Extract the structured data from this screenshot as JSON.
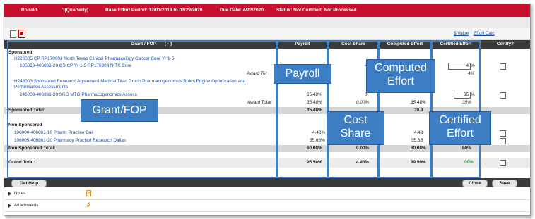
{
  "header": {
    "name": "Ronald",
    "type": "' (Quarterly)",
    "period": "Base Effort Period: 12/01/2019 to 02/29/2020",
    "due": "Due Date: 4/22/2020",
    "status": "Status: Not Certified, Not Processed"
  },
  "toolbar": {
    "value_link": "$ Value",
    "effort_calc_link": "Effort Calc"
  },
  "table": {
    "columns": {
      "grant_fop": "Grant / FOP",
      "expand_toggle": "[ - ]",
      "payroll": "Payroll",
      "cost_share": "Cost Share",
      "computed": "Computed Effort",
      "certified": "Certified Effort",
      "certify": "Certify?"
    },
    "sponsored_label": "Sponsored",
    "grant1": "H226005  CP RP170003 North Texas Clinical Pharmacology Cancer Core Yr 1-5",
    "fop1": "106016-406861-20  CS CP Yr 1-5 RP170003 N TX Core",
    "fop1_cost_share": "4.",
    "fop1_certified_input": "4",
    "pct": "%",
    "award_total_label": "Award Tot",
    "award1_cost_share": "4",
    "award1_certified": "4%",
    "grant2": "H246003  Sponsored Research Agreement Medical Titan Group Pharmacogenomics Rules Engine Optimization and",
    "grant2_line2": "Performance Assessments",
    "fop2": "246003-406861-20  SRG MTG Pharmacogenomics Assess",
    "fop2_payroll": "35.48%",
    "fop2_cost_share": "0.",
    "fop2_certified_input": "35",
    "award_total2_label": "Award Total:",
    "award2_payroll": "35.48%",
    "award2_cost_share": "0.00%",
    "award2_computed": "35.48%",
    "award2_certified": "35%",
    "sponsored_total_label": "Sponsored Total:",
    "sponsored_total_payroll": "35.48%",
    "sponsored_total_computed": "39.9",
    "nonsponsored_label": "Non Sponsored",
    "fop3": "106000-406861-10  Pharm Practice Dal",
    "fop3_payroll": "4.43%",
    "fop3_computed": "4.43",
    "fop4": "106005-406861-20  Pharmacy Practice Research Dallas",
    "fop4_payroll": "55.65%",
    "fop4_computed": "55.65",
    "nonsponsored_total_label": "Non Sponsored Total:",
    "nonsponsored_total_payroll": "60.08%",
    "nonsponsored_total_cost_share": "0.00%",
    "nonsponsored_total_computed": "60.08%",
    "nonsponsored_total_certified": "60%",
    "grand_total_label": "Grand Total:",
    "grand_payroll": "95.56%",
    "grand_cost_share": "4.43%",
    "grand_computed": "99.99%",
    "grand_certified": "99%"
  },
  "callouts": {
    "payroll": "Payroll",
    "computed_line1": "Computed",
    "computed_line2": "Effort",
    "grant_fop": "Grant/FOP",
    "cost_line1": "Cost",
    "cost_line2": "Share",
    "certified_line1": "Certified",
    "certified_line2": "Effort"
  },
  "buttons": {
    "get_help": "Get Help",
    "close": "Close",
    "save": "Save"
  },
  "sections": {
    "notes": "Notes",
    "attachments": "Attachments"
  },
  "colors": {
    "header_red": "#c8102e",
    "callout_blue": "#3d7dc4",
    "certified_green": "#2a9d2a"
  }
}
